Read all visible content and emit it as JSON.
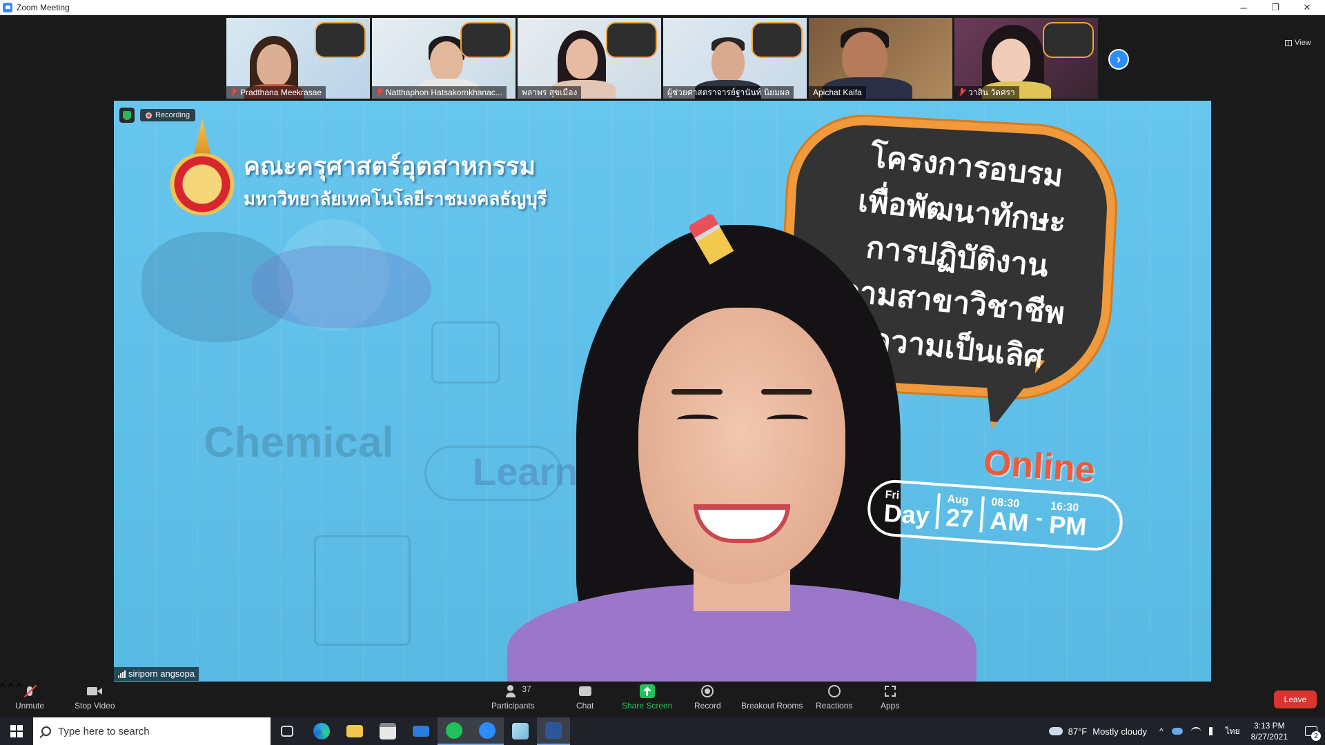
{
  "window": {
    "title": "Zoom Meeting",
    "minimize": "─",
    "restore": "❐",
    "close": "✕"
  },
  "gallery": {
    "participants": [
      {
        "name": "Pradthana Meekrasae",
        "muted": true
      },
      {
        "name": "Natthaphon Hatsakornkhanac...",
        "muted": true
      },
      {
        "name": "พลาพร สุขเมือง",
        "muted": false
      },
      {
        "name": "ผู้ช่วยศาสตราจารย์ฐานันท์ นิยมผล",
        "muted": false
      },
      {
        "name": "Apichat Kaifa",
        "muted": false
      },
      {
        "name": "วาสิน วัดศรา",
        "muted": true
      }
    ],
    "next_label": "›",
    "view_label": "View"
  },
  "main": {
    "speaker_name": "siriporn angsopa",
    "recording_label": "Recording",
    "slide": {
      "faculty_title": "คณะครุศาสตร์อุตสาหกรรม",
      "faculty_subtitle": "มหาวิทยาลัยเทคโนโลยีราชมงคลธัญบุรี",
      "headline_lines": [
        "โครงการอบรม",
        "เพื่อพัฒนาทักษะ",
        "การปฏิบัติงาน",
        "ตามสาขาวิชาชีพ",
        "สู่ความเป็นเลิศ"
      ],
      "online": "Online",
      "day_small": "Fri",
      "day_big": "Day",
      "month": "Aug",
      "date": "27",
      "start_time": "08:30",
      "start_ampm": "AM",
      "dash": "-",
      "end_time": "16:30",
      "end_ampm": "PM",
      "doodle_word_1": "Chemical",
      "doodle_word_2": "Learn"
    }
  },
  "controls": {
    "unmute": "Unmute",
    "stop_video": "Stop Video",
    "participants": "Participants",
    "participants_count": "37",
    "chat": "Chat",
    "share_screen": "Share Screen",
    "record": "Record",
    "breakout_rooms": "Breakout Rooms",
    "reactions": "Reactions",
    "apps": "Apps",
    "leave": "Leave"
  },
  "taskbar": {
    "search_placeholder": "Type here to search",
    "weather_temp": "87°F",
    "weather_desc": "Mostly cloudy",
    "lang": "ไทย",
    "time": "3:13 PM",
    "date": "8/27/2021",
    "notifications": "2",
    "tray_chevron": "^"
  },
  "colors": {
    "zoom_blue": "#2d8cff",
    "share_green": "#23c05b",
    "leave_red": "#d9352e",
    "slide_blue": "#5bbde6",
    "bubble_orange": "#f09a3c"
  }
}
